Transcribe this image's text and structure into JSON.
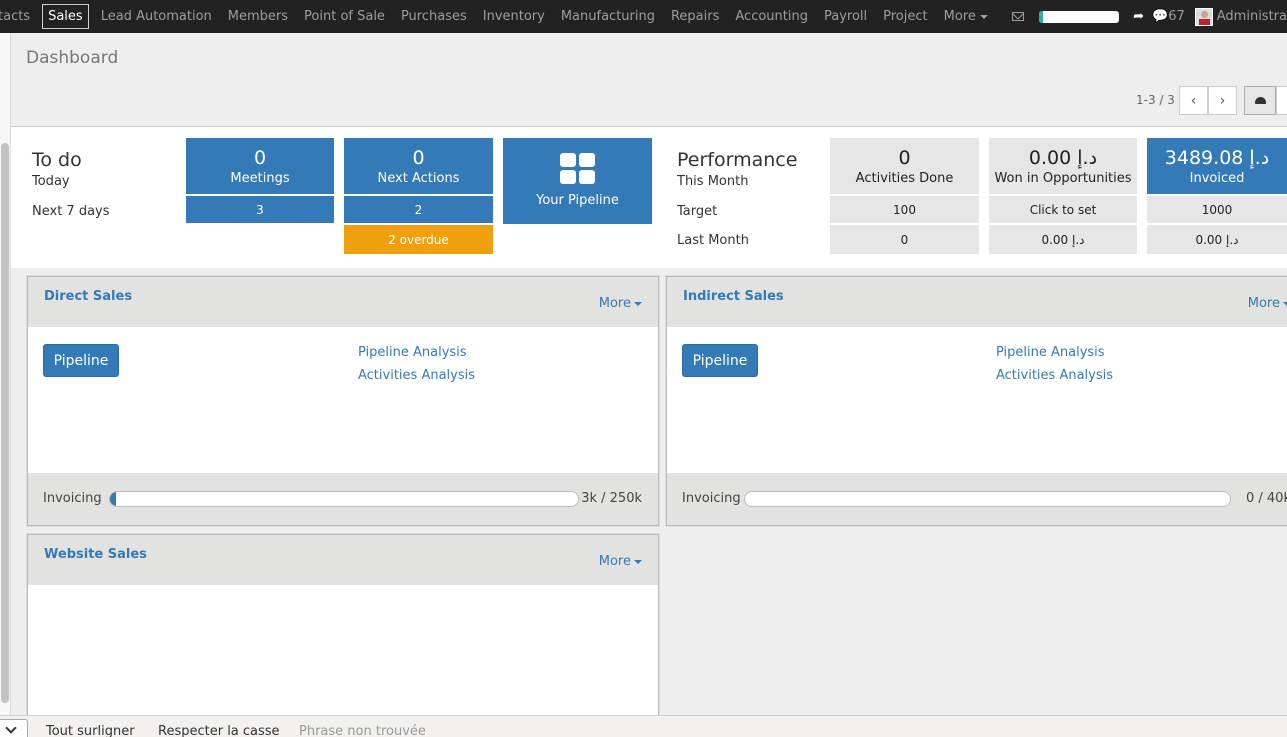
{
  "topnav": {
    "items": [
      "tacts",
      "Sales",
      "Lead Automation",
      "Members",
      "Point of Sale",
      "Purchases",
      "Inventory",
      "Manufacturing",
      "Repairs",
      "Accounting",
      "Payroll",
      "Project",
      "More"
    ],
    "active": "Sales",
    "messages_count": "67",
    "user": "Administra",
    "progress": 0.05
  },
  "control": {
    "breadcrumb": "Dashboard",
    "pager": "1-3 / 3"
  },
  "todo": {
    "title": "To do",
    "today": "Today",
    "next7": "Next 7 days",
    "meetings": {
      "today": "0",
      "label": "Meetings",
      "next7": "3"
    },
    "next_actions": {
      "today": "0",
      "label": "Next Actions",
      "next7": "2",
      "overdue": "2 overdue"
    },
    "pipeline": "Your Pipeline"
  },
  "performance": {
    "title": "Performance",
    "this_month": "This Month",
    "target": "Target",
    "last_month": "Last Month",
    "activities": {
      "value": "0",
      "label": "Activities Done",
      "target": "100",
      "last": "0"
    },
    "won": {
      "value": "0.00 د.إ",
      "label": "Won in Opportunities",
      "target": "Click to set",
      "last": "0.00 د.إ"
    },
    "invoiced": {
      "value": "3489.08 د.إ",
      "label": "Invoiced",
      "target": "1000",
      "last": "0.00 د.إ"
    }
  },
  "teams": [
    {
      "name": "Direct Sales",
      "more": "More",
      "pipeline": "Pipeline",
      "link1": "Pipeline Analysis",
      "link2": "Activities Analysis",
      "invoicing_label": "Invoicing",
      "invoicing_value": "3k / 250k",
      "invoicing_progress": 0.012
    },
    {
      "name": "Indirect Sales",
      "more": "More",
      "pipeline": "Pipeline",
      "link1": "Pipeline Analysis",
      "link2": "Activities Analysis",
      "invoicing_label": "Invoicing",
      "invoicing_value": "0 / 40k",
      "invoicing_progress": 0
    },
    {
      "name": "Website Sales",
      "more": "More"
    }
  ],
  "findbar": {
    "highlight": "Tout surligner",
    "match_case": "Respecter la casse",
    "status": "Phrase non trouvée"
  }
}
